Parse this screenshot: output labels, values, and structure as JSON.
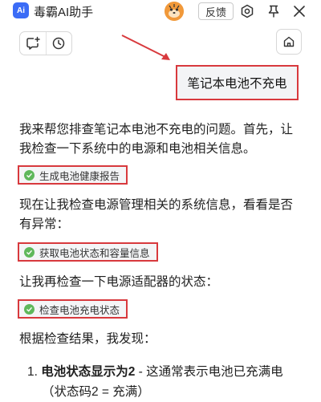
{
  "window": {
    "logo_text": "Ai",
    "title": "毒霸AI助手",
    "feedback_label": "反馈"
  },
  "conversation": {
    "user_message": "笔记本电池不充电",
    "intro_line1": "我来帮您排查笔记本电池不充电的问题。首先，让",
    "intro_line2": "我检查一下系统中的电源和电池相关信息。",
    "tool1": "生成电池健康报告",
    "power_line1": "现在让我检查电源管理相关的系统信息，看看是否",
    "power_line2": "有异常：",
    "tool2": "获取电池状态和容量信息",
    "adapter_line": "让我再检查一下电源适配器的状态：",
    "tool3": "检查电池充电状态",
    "result_line": "根据检查结果，我发现：",
    "finding1_num": "1.",
    "finding1_bold": "电池状态显示为2",
    "finding1_rest": " - 这通常表示电池已充满电",
    "finding1_line2": "（状态码2 = 充满）"
  },
  "colors": {
    "highlight_border": "#d8393d",
    "logo_blue": "#3b6cf6",
    "check_green": "#5fb85b"
  }
}
